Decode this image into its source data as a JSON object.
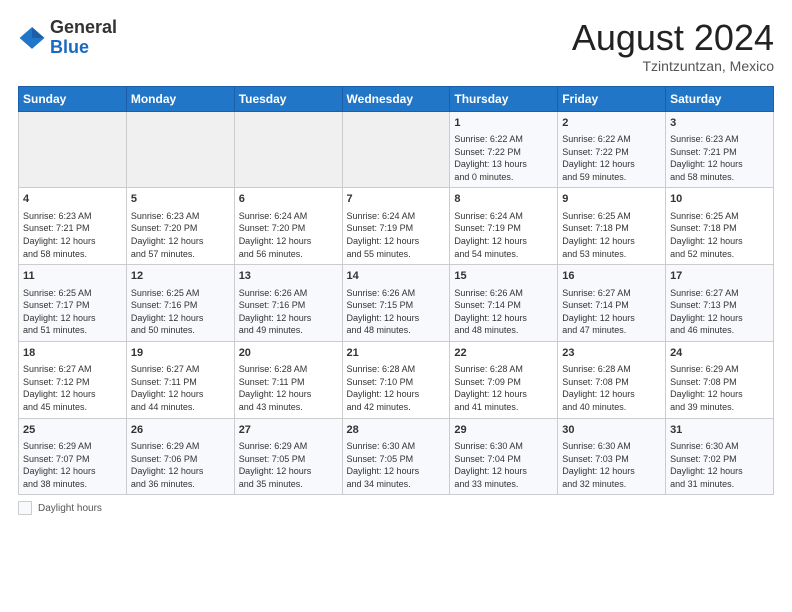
{
  "header": {
    "logo_general": "General",
    "logo_blue": "Blue",
    "month_year": "August 2024",
    "location": "Tzintzuntzan, Mexico"
  },
  "days_of_week": [
    "Sunday",
    "Monday",
    "Tuesday",
    "Wednesday",
    "Thursday",
    "Friday",
    "Saturday"
  ],
  "weeks": [
    [
      {
        "day": "",
        "info": ""
      },
      {
        "day": "",
        "info": ""
      },
      {
        "day": "",
        "info": ""
      },
      {
        "day": "",
        "info": ""
      },
      {
        "day": "1",
        "info": "Sunrise: 6:22 AM\nSunset: 7:22 PM\nDaylight: 13 hours\nand 0 minutes."
      },
      {
        "day": "2",
        "info": "Sunrise: 6:22 AM\nSunset: 7:22 PM\nDaylight: 12 hours\nand 59 minutes."
      },
      {
        "day": "3",
        "info": "Sunrise: 6:23 AM\nSunset: 7:21 PM\nDaylight: 12 hours\nand 58 minutes."
      }
    ],
    [
      {
        "day": "4",
        "info": "Sunrise: 6:23 AM\nSunset: 7:21 PM\nDaylight: 12 hours\nand 58 minutes."
      },
      {
        "day": "5",
        "info": "Sunrise: 6:23 AM\nSunset: 7:20 PM\nDaylight: 12 hours\nand 57 minutes."
      },
      {
        "day": "6",
        "info": "Sunrise: 6:24 AM\nSunset: 7:20 PM\nDaylight: 12 hours\nand 56 minutes."
      },
      {
        "day": "7",
        "info": "Sunrise: 6:24 AM\nSunset: 7:19 PM\nDaylight: 12 hours\nand 55 minutes."
      },
      {
        "day": "8",
        "info": "Sunrise: 6:24 AM\nSunset: 7:19 PM\nDaylight: 12 hours\nand 54 minutes."
      },
      {
        "day": "9",
        "info": "Sunrise: 6:25 AM\nSunset: 7:18 PM\nDaylight: 12 hours\nand 53 minutes."
      },
      {
        "day": "10",
        "info": "Sunrise: 6:25 AM\nSunset: 7:18 PM\nDaylight: 12 hours\nand 52 minutes."
      }
    ],
    [
      {
        "day": "11",
        "info": "Sunrise: 6:25 AM\nSunset: 7:17 PM\nDaylight: 12 hours\nand 51 minutes."
      },
      {
        "day": "12",
        "info": "Sunrise: 6:25 AM\nSunset: 7:16 PM\nDaylight: 12 hours\nand 50 minutes."
      },
      {
        "day": "13",
        "info": "Sunrise: 6:26 AM\nSunset: 7:16 PM\nDaylight: 12 hours\nand 49 minutes."
      },
      {
        "day": "14",
        "info": "Sunrise: 6:26 AM\nSunset: 7:15 PM\nDaylight: 12 hours\nand 48 minutes."
      },
      {
        "day": "15",
        "info": "Sunrise: 6:26 AM\nSunset: 7:14 PM\nDaylight: 12 hours\nand 48 minutes."
      },
      {
        "day": "16",
        "info": "Sunrise: 6:27 AM\nSunset: 7:14 PM\nDaylight: 12 hours\nand 47 minutes."
      },
      {
        "day": "17",
        "info": "Sunrise: 6:27 AM\nSunset: 7:13 PM\nDaylight: 12 hours\nand 46 minutes."
      }
    ],
    [
      {
        "day": "18",
        "info": "Sunrise: 6:27 AM\nSunset: 7:12 PM\nDaylight: 12 hours\nand 45 minutes."
      },
      {
        "day": "19",
        "info": "Sunrise: 6:27 AM\nSunset: 7:11 PM\nDaylight: 12 hours\nand 44 minutes."
      },
      {
        "day": "20",
        "info": "Sunrise: 6:28 AM\nSunset: 7:11 PM\nDaylight: 12 hours\nand 43 minutes."
      },
      {
        "day": "21",
        "info": "Sunrise: 6:28 AM\nSunset: 7:10 PM\nDaylight: 12 hours\nand 42 minutes."
      },
      {
        "day": "22",
        "info": "Sunrise: 6:28 AM\nSunset: 7:09 PM\nDaylight: 12 hours\nand 41 minutes."
      },
      {
        "day": "23",
        "info": "Sunrise: 6:28 AM\nSunset: 7:08 PM\nDaylight: 12 hours\nand 40 minutes."
      },
      {
        "day": "24",
        "info": "Sunrise: 6:29 AM\nSunset: 7:08 PM\nDaylight: 12 hours\nand 39 minutes."
      }
    ],
    [
      {
        "day": "25",
        "info": "Sunrise: 6:29 AM\nSunset: 7:07 PM\nDaylight: 12 hours\nand 38 minutes."
      },
      {
        "day": "26",
        "info": "Sunrise: 6:29 AM\nSunset: 7:06 PM\nDaylight: 12 hours\nand 36 minutes."
      },
      {
        "day": "27",
        "info": "Sunrise: 6:29 AM\nSunset: 7:05 PM\nDaylight: 12 hours\nand 35 minutes."
      },
      {
        "day": "28",
        "info": "Sunrise: 6:30 AM\nSunset: 7:05 PM\nDaylight: 12 hours\nand 34 minutes."
      },
      {
        "day": "29",
        "info": "Sunrise: 6:30 AM\nSunset: 7:04 PM\nDaylight: 12 hours\nand 33 minutes."
      },
      {
        "day": "30",
        "info": "Sunrise: 6:30 AM\nSunset: 7:03 PM\nDaylight: 12 hours\nand 32 minutes."
      },
      {
        "day": "31",
        "info": "Sunrise: 6:30 AM\nSunset: 7:02 PM\nDaylight: 12 hours\nand 31 minutes."
      }
    ]
  ],
  "footer": {
    "legend_label": "Daylight hours"
  }
}
